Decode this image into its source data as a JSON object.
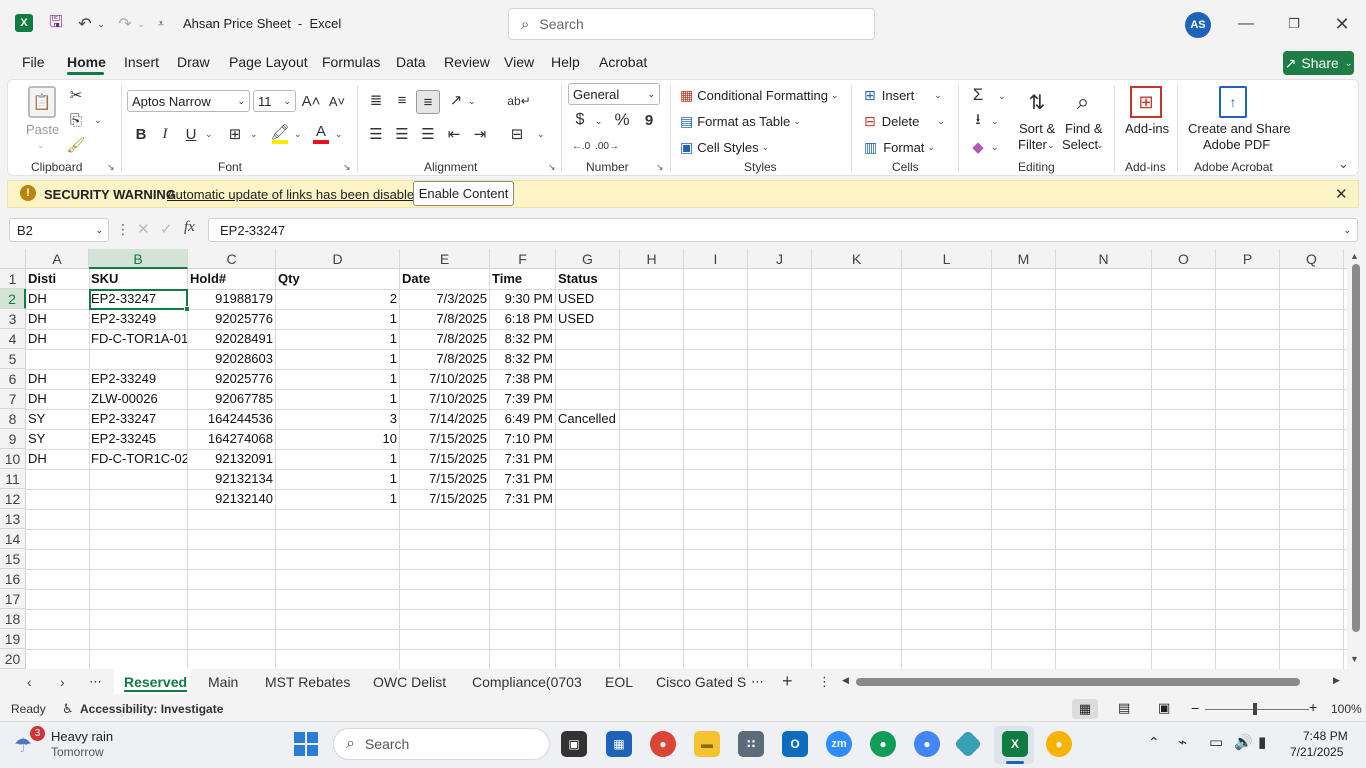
{
  "window": {
    "title": "Ahsan Price Sheet  -  Excel",
    "search_placeholder": "Search",
    "avatar": "AS"
  },
  "menu": [
    "File",
    "Home",
    "Insert",
    "Draw",
    "Page Layout",
    "Formulas",
    "Data",
    "Review",
    "View",
    "Help",
    "Acrobat"
  ],
  "share_label": "Share",
  "ribbon": {
    "clipboard": {
      "paste": "Paste",
      "label": "Clipboard"
    },
    "font": {
      "name": "Aptos Narrow",
      "size": "11",
      "label": "Font",
      "bold": "B",
      "italic": "I",
      "underline": "U"
    },
    "alignment": {
      "label": "Alignment"
    },
    "number": {
      "format": "General",
      "label": "Number",
      "currency": "$",
      "percent": "%",
      "comma": "9"
    },
    "styles": {
      "cond": "Conditional Formatting",
      "table": "Format as Table",
      "cellstyles": "Cell Styles",
      "label": "Styles"
    },
    "cells": {
      "insert": "Insert",
      "delete": "Delete",
      "format": "Format",
      "label": "Cells"
    },
    "editing": {
      "sort1": "Sort &",
      "sort2": "Filter",
      "find1": "Find &",
      "find2": "Select",
      "label": "Editing"
    },
    "addins": {
      "btn": "Add-ins",
      "label": "Add-ins"
    },
    "acrobat": {
      "btn1": "Create and Share",
      "btn2": "Adobe PDF",
      "label": "Adobe Acrobat"
    }
  },
  "warning": {
    "title": "SECURITY WARNING",
    "message": "Automatic update of links has been disabled",
    "button": "Enable Content"
  },
  "formula_bar": {
    "name_box": "B2",
    "fx": "fx",
    "content": "EP2-33247"
  },
  "columns": [
    "A",
    "B",
    "C",
    "D",
    "E",
    "F",
    "G",
    "H",
    "I",
    "J",
    "K",
    "L",
    "M",
    "N",
    "O",
    "P",
    "Q"
  ],
  "row_numbers": [
    "1",
    "2",
    "3",
    "4",
    "5",
    "6",
    "7",
    "8",
    "9",
    "10",
    "11",
    "12",
    "13",
    "14",
    "15",
    "16",
    "17",
    "18",
    "19",
    "20"
  ],
  "table": {
    "headers": [
      "Disti",
      "SKU",
      "Hold#",
      "Qty",
      "Date",
      "Time",
      "Status"
    ],
    "rows": [
      [
        "DH",
        "EP2-33247",
        "91988179",
        "2",
        "7/3/2025",
        "9:30 PM",
        "USED"
      ],
      [
        "DH",
        "EP2-33249",
        "92025776",
        "1",
        "7/8/2025",
        "6:18 PM",
        "USED"
      ],
      [
        "DH",
        "FD-C-TOR1A-01",
        "92028491",
        "1",
        "7/8/2025",
        "8:32 PM",
        ""
      ],
      [
        "",
        "",
        "92028603",
        "1",
        "7/8/2025",
        "8:32 PM",
        ""
      ],
      [
        "DH",
        "EP2-33249",
        "92025776",
        "1",
        "7/10/2025",
        "7:38 PM",
        ""
      ],
      [
        "DH",
        "ZLW-00026",
        "92067785",
        "1",
        "7/10/2025",
        "7:39 PM",
        ""
      ],
      [
        "SY",
        "EP2-33247",
        "164244536",
        "3",
        "7/14/2025",
        "6:49 PM",
        "Cancelled"
      ],
      [
        "SY",
        "EP2-33245",
        "164274068",
        "10",
        "7/15/2025",
        "7:10 PM",
        ""
      ],
      [
        "DH",
        "FD-C-TOR1C-02",
        "92132091",
        "1",
        "7/15/2025",
        "7:31 PM",
        ""
      ],
      [
        "",
        "",
        "92132134",
        "1",
        "7/15/2025",
        "7:31 PM",
        ""
      ],
      [
        "",
        "",
        "92132140",
        "1",
        "7/15/2025",
        "7:31 PM",
        ""
      ]
    ]
  },
  "sheet_tabs": [
    "Reserved",
    "Main",
    "MST Rebates",
    "OWC Delist",
    "Compliance(0703",
    "EOL",
    "Cisco Gated S"
  ],
  "status": {
    "ready": "Ready",
    "accessibility": "Accessibility: Investigate",
    "zoom": "100%"
  },
  "taskbar": {
    "weather_badge": "3",
    "weather_title": "Heavy rain",
    "weather_sub": "Tomorrow",
    "search": "Search",
    "time": "7:48 PM",
    "date": "7/21/2025",
    "zoom_app": "zm"
  }
}
